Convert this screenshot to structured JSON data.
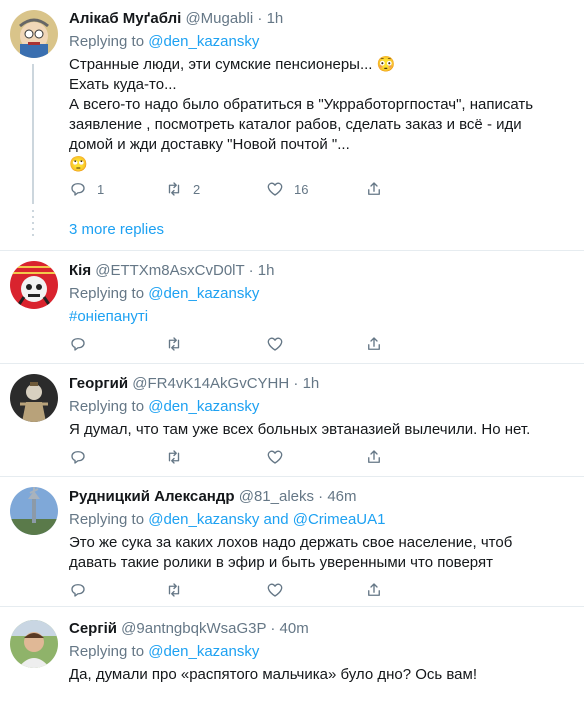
{
  "tweets": [
    {
      "name": "Алікаб Муґаблі",
      "handle": "@Mugabli",
      "dot": "·",
      "time": "1h",
      "replying_prefix": "Replying to",
      "replying_to": "@den_kazansky",
      "text_lines": [
        "Странные люди, эти сумские пенсионеры... 😳",
        "Ехать куда-то...",
        "А всего-то надо было обратиться в \"Укрработоргпостач\", написать",
        "заявление , посмотреть каталог рабов, сделать заказ и всё - иди",
        "домой и жди доставку \"Новой почтой \"...",
        "🙄"
      ],
      "reply_count": "1",
      "retweet_count": "2",
      "like_count": "16",
      "more_replies": "3 more replies"
    },
    {
      "name": "Кія",
      "handle": "@ETTXm8AsxCvD0lT",
      "dot": "·",
      "time": "1h",
      "replying_prefix": "Replying to",
      "replying_to": "@den_kazansky",
      "hashtag": "#онiепанутi"
    },
    {
      "name": "Георгий",
      "handle": "@FR4vK14AkGvCYHH",
      "dot": "·",
      "time": "1h",
      "replying_prefix": "Replying to",
      "replying_to": "@den_kazansky",
      "text": "Я думал, что там уже всех больных эвтаназией вылечили. Но нет."
    },
    {
      "name": "Рудницкий Александр",
      "handle": "@81_aleks",
      "dot": "·",
      "time": "46m",
      "replying_prefix": "Replying to",
      "replying_to": "@den_kazansky",
      "replying_and": "and",
      "replying_to_2": "@CrimeaUA1",
      "text_lines": [
        "Это же сука за каких лохов надо держать свое население, чтоб",
        "давать такие ролики в эфир и быть уверенными что поверят"
      ]
    },
    {
      "name": "Сергій",
      "handle": "@9antngbqkWsaG3P",
      "dot": "·",
      "time": "40m",
      "replying_prefix": "Replying to",
      "replying_to": "@den_kazansky",
      "text": "Да, думали про «распятого мальчика» було дно? Ось вам!"
    }
  ],
  "icons": {
    "reply": "reply-icon",
    "retweet": "retweet-icon",
    "like": "heart-icon",
    "share": "share-icon"
  },
  "colors": {
    "link": "#1da1f2",
    "secondary": "#657786",
    "border": "#e6ecf0"
  }
}
